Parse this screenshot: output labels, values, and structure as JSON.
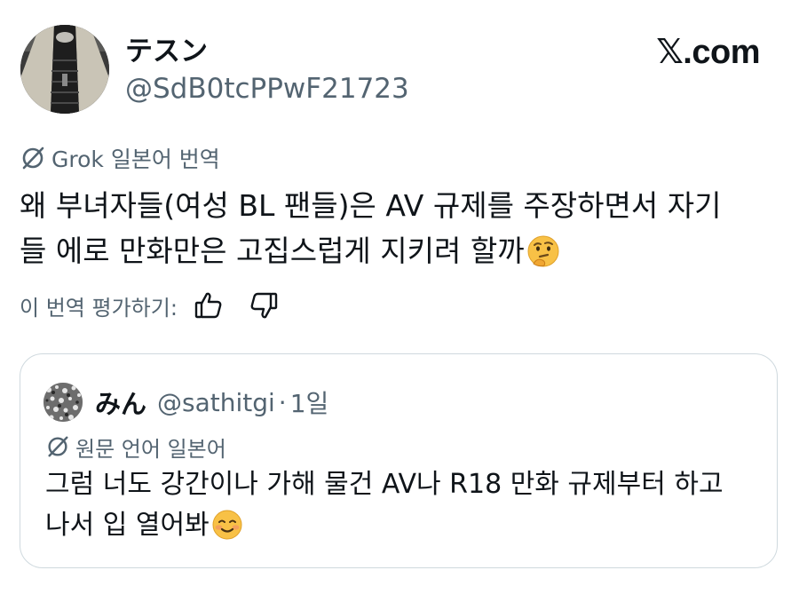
{
  "tweet": {
    "display_name": "テスン",
    "handle": "@SdB0tcPPwF21723",
    "source_brand": "𝕏.com",
    "translation_label": "Grok 일본어 번역",
    "text_line1": "왜 부녀자들(여성 BL 팬들)은 AV 규제를 주장하면서 자기",
    "text_line2": "들 에로 만화만은 고집스럽게 지키려 할까",
    "emoji": "thinking-face",
    "rate_prompt": "이 번역 평가하기:",
    "icons": {
      "avatar": "stairway-photo",
      "translate": "grok-slash-icon",
      "thumbs_up": "thumbs-up-icon",
      "thumbs_down": "thumbs-down-icon"
    }
  },
  "quote": {
    "display_name": "みん",
    "handle": "@sathitgi",
    "separator": "·",
    "time": "1일",
    "language_label": "원문 언어 일본어",
    "text_line1": "그럼 너도 강간이나 가해 물건 AV나 R18 만화 규제부터 하고",
    "text_line2": "나서 입 열어봐",
    "emoji": "smiling-face"
  },
  "colors": {
    "text_primary": "#0f1419",
    "text_secondary": "#536471",
    "border": "#cfd9de",
    "background": "#ffffff"
  }
}
